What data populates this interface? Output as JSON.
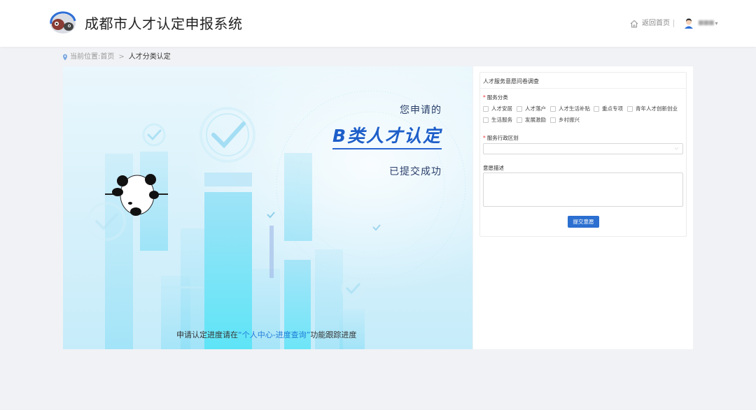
{
  "header": {
    "title": "成都市人才认定申报系统",
    "home_label": "返回首页",
    "user_name": "■■■",
    "logo_icon": "panda-logo-icon",
    "home_icon": "home-icon",
    "avatar_icon": "user-avatar-icon"
  },
  "breadcrumb": {
    "prefix": "当前位置:",
    "home": "首页",
    "separator": ">",
    "current": "人才分类认定"
  },
  "banner": {
    "line1": "您申请的",
    "line2": "B类人才认定",
    "line3": "已提交成功",
    "footer_before": "申请认定进度请在",
    "footer_link": "“个人中心-进度查询”",
    "footer_after": "功能跟踪进度"
  },
  "survey": {
    "title": "人才服务意愿问卷调查",
    "category_label": "服务分类",
    "categories": [
      "人才安居",
      "人才落户",
      "人才生活补贴",
      "重点专项",
      "青年人才创新创业",
      "生活服务",
      "发展激励",
      "乡村振兴"
    ],
    "region_label": "服务行政区划",
    "region_value": "",
    "desc_label": "意愿描述",
    "desc_value": "",
    "submit_label": "提交意愿"
  },
  "colors": {
    "accent": "#2b6fd0",
    "headline": "#1d5ec9",
    "link": "#1d7ad8",
    "required": "#e33333"
  }
}
